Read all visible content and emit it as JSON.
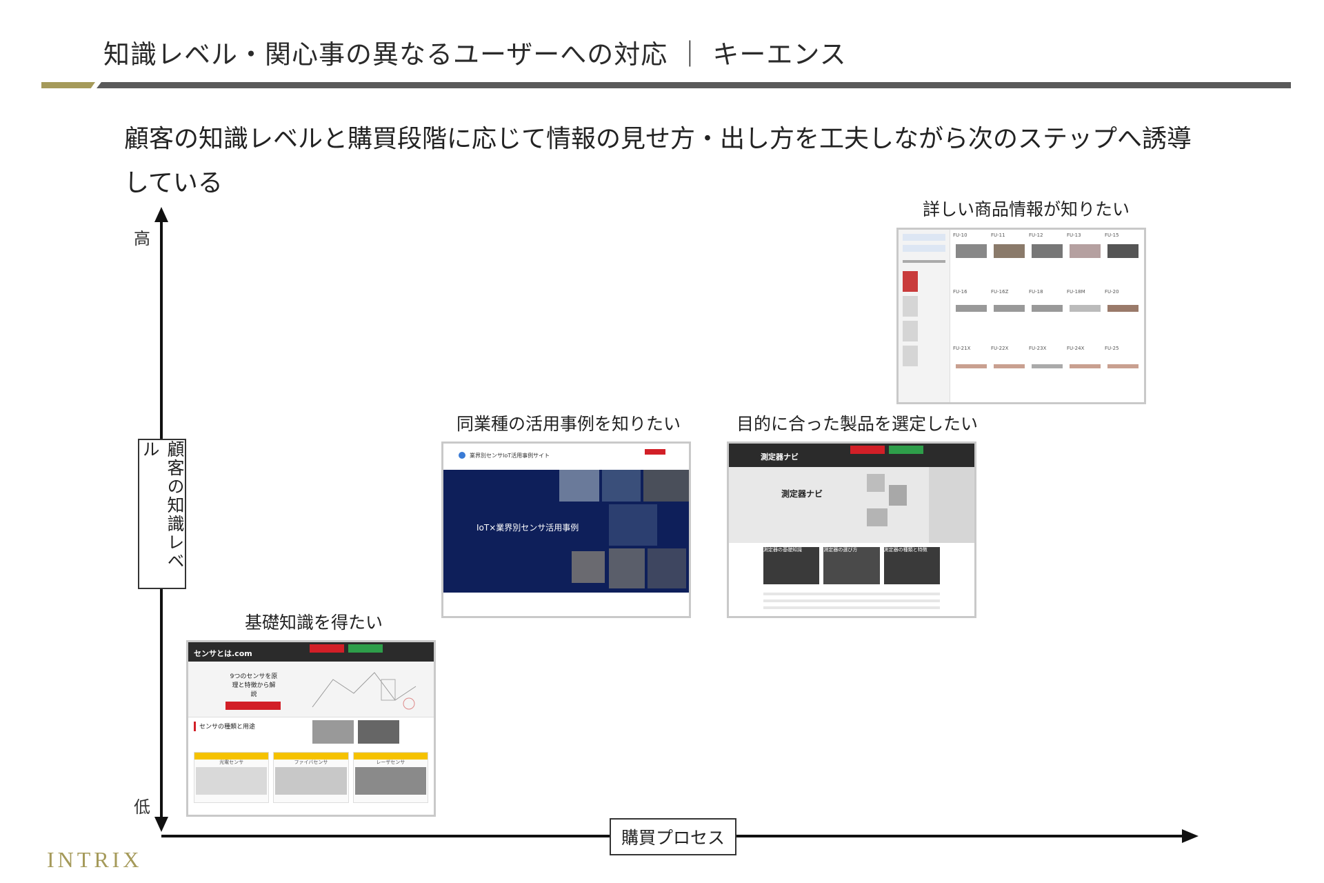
{
  "header": {
    "title": "知識レベル・関心事の異なるユーザーへの対応 ｜ キーエンス",
    "accent_color": "#a59a5a",
    "rule_color": "#5a5a5a"
  },
  "headline": "顧客の知識レベルと購買段階に応じて情報の見せ方・出し方を工夫しながら次のステップへ誘導している",
  "axes": {
    "y_label": "顧客の知識レベル",
    "y_high": "高",
    "y_low": "低",
    "x_label": "購買プロセス"
  },
  "stages": [
    {
      "caption": "基礎知識を得たい",
      "site_name": "センサとは.com",
      "hero_text": "9つのセンサを原理と特徴から解説",
      "section_title": "センサの種類と用途",
      "cards": [
        "光電センサ",
        "ファイバセンサ",
        "レーザセンサ"
      ]
    },
    {
      "caption": "同業種の活用事例を知りたい",
      "site_name": "業界別センサIoT活用事例サイト",
      "hero_text": "IoT×業界別センサ活用事例"
    },
    {
      "caption": "目的に合った製品を選定したい",
      "site_name": "測定器ナビ",
      "hero_text": "測定器ナビ",
      "tiles": [
        "測定器の基礎知識",
        "測定器の選び方",
        "測定器の種類と特徴"
      ]
    },
    {
      "caption": "詳しい商品情報が知りたい",
      "products": [
        "FU-10",
        "FU-11",
        "FU-12",
        "FU-13",
        "FU-15",
        "FU-16",
        "FU-16Z",
        "FU-18",
        "FU-18M",
        "FU-20",
        "FU-21X",
        "FU-22X",
        "FU-23X",
        "FU-24X",
        "FU-25"
      ]
    }
  ],
  "footer": {
    "logo": "INTRIX"
  }
}
